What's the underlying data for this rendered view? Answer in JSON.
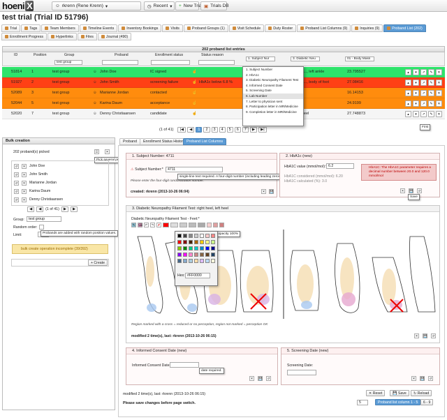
{
  "app": {
    "logo": "hoeni",
    "logo_x": "X",
    "user": "rkrenn (Rene Krenn)",
    "recent": "Recent",
    "new_trial": "New Trial",
    "trials_db": "Trials DB"
  },
  "page": {
    "title": "test trial (Trial ID 51796)"
  },
  "main_tabs": [
    {
      "label": "Trial"
    },
    {
      "label": "Tags"
    },
    {
      "label": "Team Members"
    },
    {
      "label": "Timeline Events"
    },
    {
      "label": "Inventory Bookings"
    },
    {
      "label": "Visits"
    },
    {
      "label": "Proband Groups (1)"
    },
    {
      "label": "Visit Schedule"
    },
    {
      "label": "Duty Roster"
    },
    {
      "label": "Proband List Columns (9)"
    },
    {
      "label": "Inquiries (9)"
    },
    {
      "label": "Proband List (202)"
    },
    {
      "label": "Enrollment Progress"
    },
    {
      "label": "Hyperlinks"
    },
    {
      "label": "Files"
    },
    {
      "label": "Journal (490)"
    }
  ],
  "list": {
    "header": "202 proband list entries",
    "columns": {
      "id": "ID",
      "position": "Position",
      "group": "Group",
      "group_filter": "test group",
      "proband": "Proband",
      "enrollment": "Enrollment status",
      "status_reason": "Status reason",
      "col1": "1. Subject Nur",
      "col2": "3. Diabetic Neu",
      "col3": "01 - Body Mass"
    },
    "rows": [
      {
        "id": "51814",
        "pos": "1",
        "group": "test group",
        "proband": "John Doe",
        "status": "IC signed",
        "reason": "",
        "c1": "",
        "c2": "ulcer..., left ankle",
        "c3": "23.795527"
      },
      {
        "id": "51927",
        "pos": "2",
        "group": "test group",
        "proband": "John Smith",
        "status": "screening failure",
        "reason": "HbA1c below 6.8 %",
        "c1": "",
        "c2": "ulcer..., body of foot",
        "c3": "27.08416"
      },
      {
        "id": "52089",
        "pos": "3",
        "group": "test group",
        "proband": "Marianne Jordan",
        "status": "contacted",
        "reason": "",
        "c1": "",
        "c2": "",
        "c3": "16.14153"
      },
      {
        "id": "52044",
        "pos": "5",
        "group": "test group",
        "proband": "Karina Daum",
        "status": "acceptance",
        "reason": "",
        "c1": "",
        "c2": "",
        "c3": "24.9199"
      },
      {
        "id": "52020",
        "pos": "7",
        "group": "test group",
        "proband": "Denny Christiaansen",
        "status": "candidate",
        "reason": "",
        "c1": "",
        "c2": "left heel",
        "c3": "27.748873"
      }
    ],
    "pager": {
      "info": "(1 of 41)",
      "pages": [
        "1",
        "2",
        "3",
        "4",
        "5",
        "6",
        "7"
      ],
      "current": "1",
      "tip": "First"
    },
    "column_dropdown": [
      "1. Subject Number",
      "2. HbA1c",
      "3. Diabetic Neuropathy Filament Test",
      "4. Informed Consent Date",
      "5. Screening Date",
      "6. Lab Number",
      "7. Letter to physician sent",
      "8. Participation letter in MR/Medicine",
      "9. Completion letter in MR/Medicine"
    ]
  },
  "bulk": {
    "title": "Bulk creation",
    "picked": "202 proband(s) picked",
    "pick_tip": "Pick several probands at once",
    "items": [
      "John Doe",
      "John Smith",
      "Marianne Jordan",
      "Karina Daum",
      "Denny Christiaansen"
    ],
    "pager": "(1 of 41)",
    "group_label": "Group:",
    "group_value": "test group",
    "random_label": "Random order:",
    "random_tip": "Probands are added with random position values.",
    "limit_label": "Limit:",
    "warning": "bulk create operation incomplete (39/392)",
    "create": "Create"
  },
  "sub_tabs": [
    {
      "label": "Proband"
    },
    {
      "label": "Enrollment Status History"
    },
    {
      "label": "Proband List Columns"
    }
  ],
  "form": {
    "c1_title": "1. Subject Number: 4711",
    "c1_label": "Subject Number:*",
    "c1_value": "4711",
    "c1_hint": "single-line text required. A four-digit number (including leading zeros) is required.",
    "c1_note": "Please enter the four-digit randomization number.",
    "c1_footer": "created: rkrenn (2013-10-26 06:04)",
    "c2_title": "2. HbA1c (new)",
    "c2_label": "HbA1C value (mmol/mol):*",
    "c2_value": "6.2",
    "c2_error": "HbA1C: The HbA1C parameter requires a decimal number between 20.0 and 120.0 mmol/mol",
    "c2_calc1": "HbA1C considered (mmol/mol): 6.20",
    "c2_calc2": "HbA1C calculated (%): 3.0",
    "c2_save_tip": "Save",
    "c3_title": "3. Diabetic Neuropathy Filament Test: right heel, left heel",
    "c3_label": "Diabetic Neuropathy Filament Test - Feet:*",
    "c3_opacity_tip": "pen opacity 100%",
    "c3_hex_label": "Hex:",
    "c3_hex": "#FF0000",
    "c3_note": "Region marked with a cross = reduced or no perception, region not marked = perception OK",
    "c3_footer": "modified 2 time(s), last: rkrenn (2013-10-26 06:15)",
    "c4_title": "4. Informed Consent Date (new)",
    "c4_label": "Informed Consent Date:*",
    "c4_hint": "date required.",
    "c5_title": "5. Screening Date (new)",
    "c5_label": "Screening Date:"
  },
  "bottom": {
    "modified": "modified 2 time(s), last: rkrenn (2013-10-26 06:15)",
    "reset": "Reset",
    "save": "Save",
    "reload": "Reload",
    "note": "Please save changes before page switch.",
    "page_size": "5",
    "columns_btn": "Proband list column 1 - 5",
    "range": "6 - 9"
  },
  "colors": {
    "green": "#2ee36b",
    "red": "#ff4015",
    "orange": "#ff8c0d",
    "accent": "#5b9bd5"
  }
}
